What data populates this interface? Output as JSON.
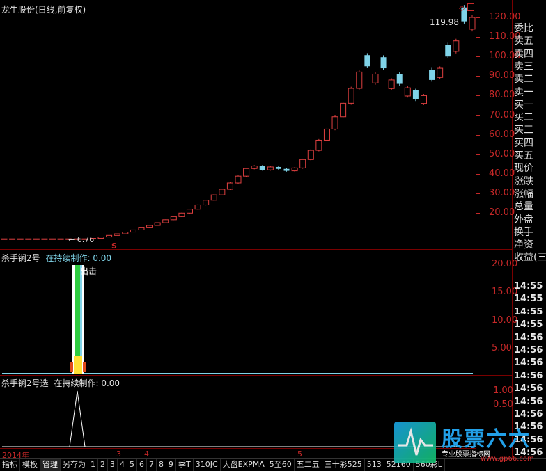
{
  "window": {
    "title": "龙生股份(日线,前复权)"
  },
  "main_chart": {
    "price_marker": "119.98",
    "low_marker": "6.76",
    "signal_marker": "S",
    "y_ticks": [
      "120.00",
      "110.00",
      "100.00",
      "90.00",
      "80.00",
      "70.00",
      "60.00",
      "50.00",
      "40.00",
      "30.00",
      "20.00"
    ]
  },
  "indicator1": {
    "name": "杀手锏2号",
    "status": "在持续制作: 0.00",
    "signal_label": "出击",
    "y_ticks": [
      "20.00",
      "15.00",
      "10.00",
      "5.00"
    ]
  },
  "indicator2": {
    "name": "杀手锏2号选",
    "status": "在持续制作: 0.00",
    "y_ticks": [
      "1.00",
      "0.50"
    ]
  },
  "time_axis": {
    "labels": [
      "2014年",
      "3",
      "4",
      "5"
    ]
  },
  "right_panel": {
    "items": [
      "委比",
      "卖五",
      "卖四",
      "卖三",
      "卖二",
      "卖一",
      "买一",
      "买二",
      "买三",
      "买四",
      "买五",
      "现价",
      "涨跌",
      "涨幅",
      "总量",
      "外盘",
      "换手",
      "净资",
      "收益(三"
    ],
    "times": [
      "14:55",
      "14:55",
      "14:55",
      "14:55",
      "14:56",
      "14:56",
      "14:56",
      "14:56",
      "14:56",
      "14:56",
      "14:56",
      "14:56",
      "14:56",
      "14:56"
    ]
  },
  "tabs": [
    "指标",
    "模板",
    "管理",
    "另存为",
    "1",
    "2",
    "3",
    "4",
    "5",
    "6",
    "7",
    "8",
    "9",
    "季T",
    "310JC",
    "大盘EXPMA",
    "5至60",
    "五二五",
    "三十彩525",
    "513",
    "52160",
    "560彩L"
  ],
  "watermark": {
    "text": "股票六六",
    "url": "www.gp66.com",
    "slogan": "专业股票指标网"
  },
  "chart_data": {
    "type": "candlestick",
    "series": [
      {
        "name": "close",
        "values": [
          6.76,
          6.76,
          6.76,
          6.76,
          6.76,
          6.76,
          6.76,
          6.76,
          6.76,
          6.76,
          6.76,
          7.0,
          7.7,
          8.5,
          9.3,
          10.2,
          11.3,
          12.4,
          13.6,
          15.0,
          16.5,
          18.1,
          19.9,
          21.9,
          24.1,
          26.5,
          29.2,
          32.1,
          35.3,
          38.8,
          42.7,
          44.0,
          42.0,
          43.5,
          42.5,
          41.5,
          43.0,
          47.3,
          52.0,
          57.2,
          62.9,
          69.2,
          76.1,
          83.7,
          92.1,
          95.0,
          91.0,
          94.0,
          88.0,
          86.0,
          84.0,
          78.0,
          80.0,
          88.0,
          94.0,
          100.0,
          108.0,
          118.0,
          119.98
        ]
      }
    ]
  }
}
